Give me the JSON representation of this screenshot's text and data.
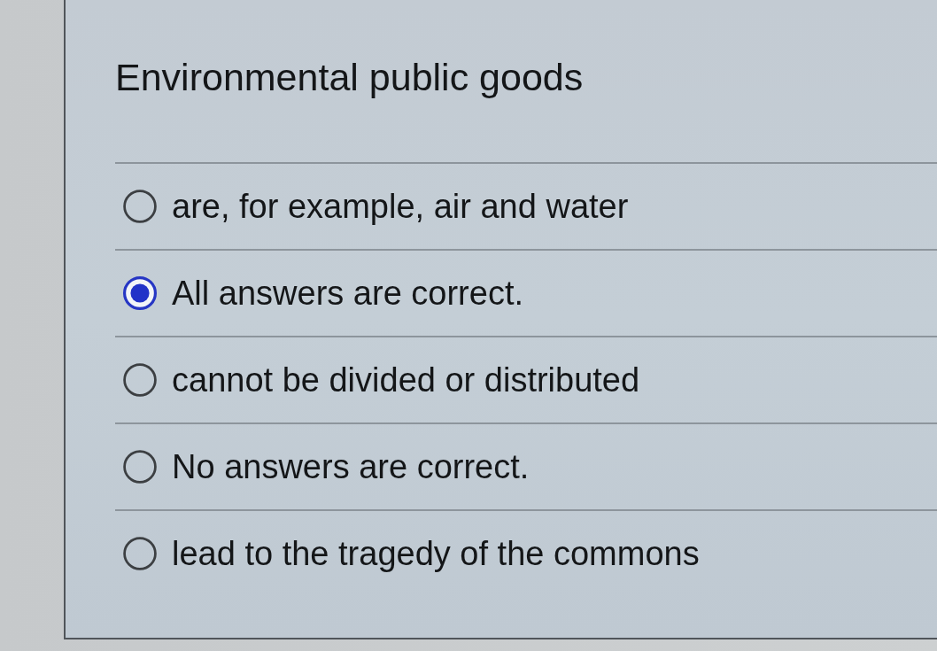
{
  "question": {
    "text": "Environmental public goods"
  },
  "options": [
    {
      "label": "are, for example, air and water",
      "selected": false
    },
    {
      "label": "All answers are correct.",
      "selected": true
    },
    {
      "label": "cannot be divided or distributed",
      "selected": false
    },
    {
      "label": "No answers are correct.",
      "selected": false
    },
    {
      "label": "lead to the tragedy of the commons",
      "selected": false
    }
  ]
}
